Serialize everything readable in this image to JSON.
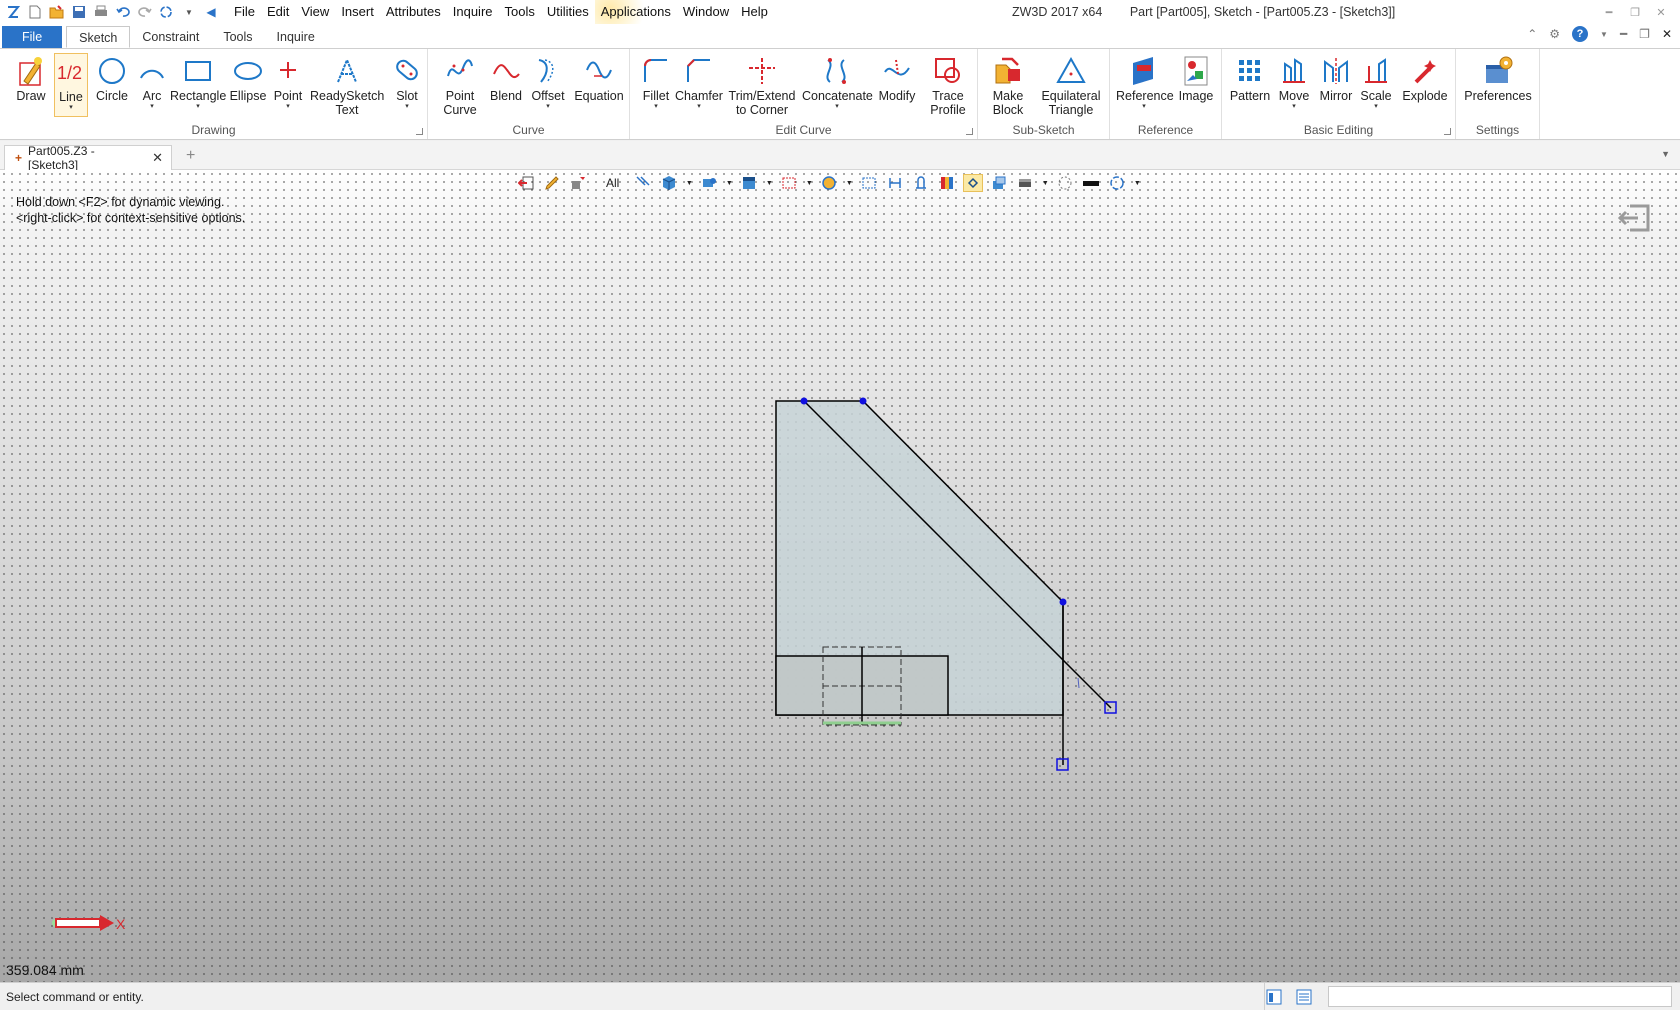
{
  "menu": {
    "items": [
      "File",
      "Edit",
      "View",
      "Insert",
      "Attributes",
      "Inquire",
      "Tools",
      "Utilities",
      "Applications",
      "Window",
      "Help"
    ]
  },
  "window": {
    "app": "ZW3D 2017  x64",
    "title": "Part [Part005],  Sketch - [Part005.Z3 - [Sketch3]]"
  },
  "ribbon_tabs": {
    "file": "File",
    "tabs": [
      "Sketch",
      "Constraint",
      "Tools",
      "Inquire"
    ]
  },
  "groups": {
    "drawing": "Drawing",
    "curve": "Curve",
    "edit_curve": "Edit Curve",
    "sub_sketch": "Sub-Sketch",
    "reference": "Reference",
    "basic_editing": "Basic Editing",
    "settings": "Settings"
  },
  "buttons": {
    "draw": "Draw",
    "line": "Line",
    "circle": "Circle",
    "arc": "Arc",
    "rectangle": "Rectangle",
    "ellipse": "Ellipse",
    "point": "Point",
    "readysketch_1": "ReadySketch",
    "readysketch_2": "Text",
    "slot": "Slot",
    "point_curve_1": "Point",
    "point_curve_2": "Curve",
    "blend": "Blend",
    "offset": "Offset",
    "equation": "Equation",
    "fillet": "Fillet",
    "chamfer": "Chamfer",
    "trim_1": "Trim/Extend",
    "trim_2": "to Corner",
    "concatenate": "Concatenate",
    "modify": "Modify",
    "trace_1": "Trace",
    "trace_2": "Profile",
    "make_block_1": "Make",
    "make_block_2": "Block",
    "equilateral_1": "Equilateral",
    "equilateral_2": "Triangle",
    "reference": "Reference",
    "image": "Image",
    "pattern": "Pattern",
    "move": "Move",
    "mirror": "Mirror",
    "scale": "Scale",
    "explode": "Explode",
    "preferences": "Preferences",
    "line_icon_text": "1/2",
    "dropdown": "▾"
  },
  "doc_tab": {
    "label": "Part005.Z3 - [Sketch3]",
    "close": "✕"
  },
  "viewport": {
    "hint_1": "Hold down <F2> for dynamic viewing.",
    "hint_2": "<right-click> for context-sensitive options.",
    "filter": "All",
    "axis_label": "X",
    "measurement": "359.084 mm"
  },
  "status": {
    "text": "Select command or entity."
  },
  "colors": {
    "accent": "#2a73c8",
    "icon_red": "#d8282e",
    "icon_blue": "#1e78c8",
    "sketch_fill": "#c7d3d7",
    "selected_point": "#1010e0"
  }
}
